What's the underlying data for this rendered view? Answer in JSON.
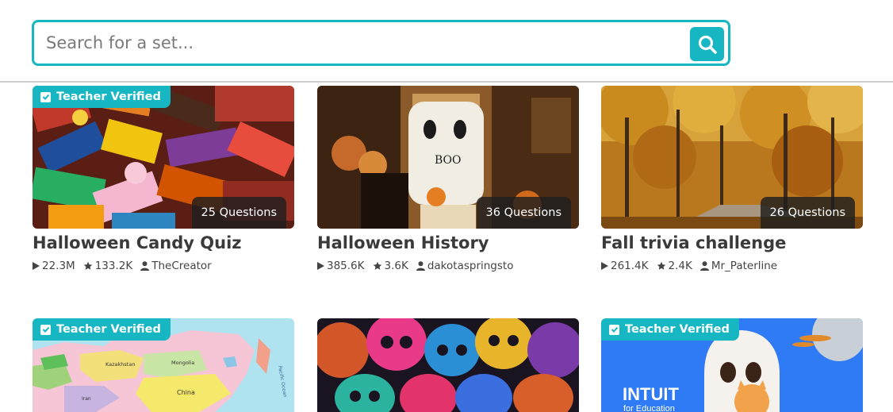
{
  "search": {
    "placeholder": "Search for a set..."
  },
  "colors": {
    "accent": "#16b6c3"
  },
  "cards": [
    {
      "verified": "Teacher Verified",
      "questions": "25 Questions",
      "title": "Halloween Candy Quiz",
      "plays": "22.3M",
      "favorites": "133.2K",
      "author": "TheCreator",
      "image": "halloween-candy-photo"
    },
    {
      "questions": "36 Questions",
      "title": "Halloween History",
      "plays": "385.6K",
      "favorites": "3.6K",
      "author": "dakotaspringsto",
      "image": "halloween-porch-ghost-boo-photo"
    },
    {
      "questions": "26 Questions",
      "title": "Fall trivia challenge",
      "plays": "261.4K",
      "favorites": "2.4K",
      "author": "Mr_Paterline",
      "image": "autumn-forest-road-photo"
    },
    {
      "verified": "Teacher Verified",
      "image": "asia-political-map",
      "map_labels": [
        "Kazakhstan",
        "Mongolia",
        "China",
        "Iran",
        "Pacific Ocean"
      ]
    },
    {
      "image": "colorful-sugar-skulls-photo"
    },
    {
      "verified": "Teacher Verified",
      "image": "intuit-ghost-illustration",
      "logo": "INTUIT",
      "logo_sub": "for Education"
    }
  ]
}
